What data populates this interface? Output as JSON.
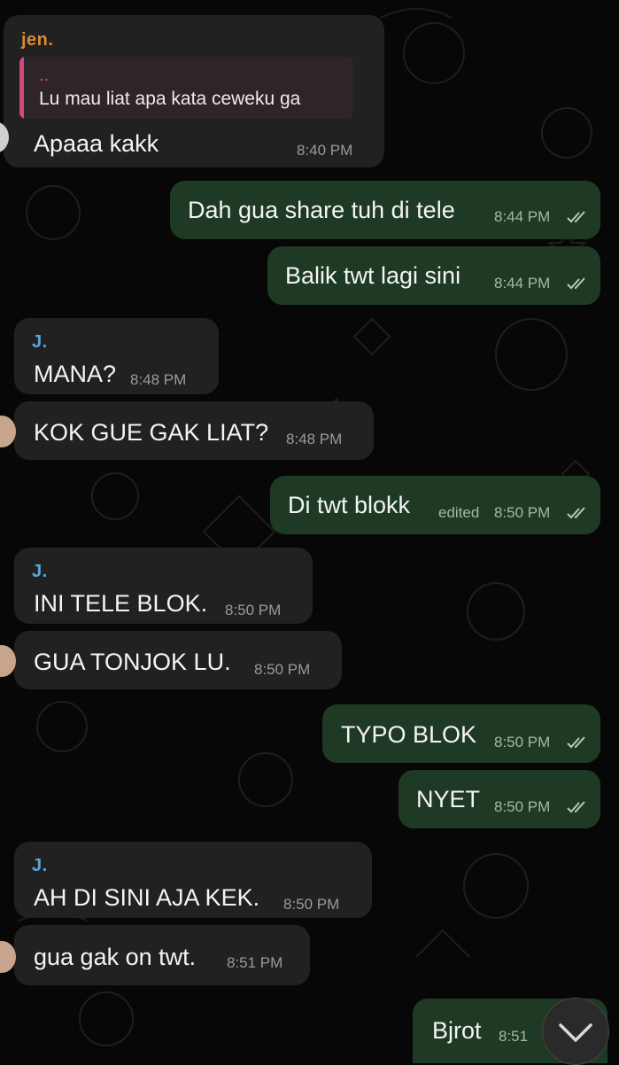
{
  "colors": {
    "background": "#070707",
    "incoming_bubble": "#212121",
    "outgoing_bubble": "#1f3a24",
    "sender_jen": "#d98a35",
    "sender_j": "#56a9d8",
    "reply_accent": "#d14a80"
  },
  "messages": [
    {
      "dir": "in",
      "sender": "jen.",
      "reply_author": "..",
      "reply_text": "Lu mau liat apa kata ceweku ga",
      "text": "Apaaa kakk",
      "time": "8:40 PM"
    },
    {
      "dir": "out",
      "text": "Dah gua share tuh di tele",
      "time": "8:44 PM"
    },
    {
      "dir": "out",
      "text": "Balik twt lagi sini",
      "time": "8:44 PM"
    },
    {
      "dir": "in",
      "sender": "J.",
      "text": "MANA?",
      "time": "8:48 PM"
    },
    {
      "dir": "in",
      "text": "KOK GUE GAK LIAT?",
      "time": "8:48 PM"
    },
    {
      "dir": "out",
      "text": "Di twt blokk",
      "edited": "edited",
      "time": "8:50 PM"
    },
    {
      "dir": "in",
      "sender": "J.",
      "text": "INI TELE BLOK.",
      "time": "8:50 PM"
    },
    {
      "dir": "in",
      "text": "GUA TONJOK LU.",
      "time": "8:50 PM"
    },
    {
      "dir": "out",
      "text": "TYPO BLOK",
      "time": "8:50 PM"
    },
    {
      "dir": "out",
      "text": "NYET",
      "time": "8:50 PM"
    },
    {
      "dir": "in",
      "sender": "J.",
      "text": "AH DI SINI AJA KEK.",
      "time": "8:50 PM"
    },
    {
      "dir": "in",
      "text": "gua gak on twt.",
      "time": "8:51 PM"
    },
    {
      "dir": "out",
      "text": "Bjrot",
      "time": "8:51"
    }
  ],
  "icons": {
    "read_receipt": "double-check-icon",
    "scroll_down": "chevron-down-icon"
  }
}
